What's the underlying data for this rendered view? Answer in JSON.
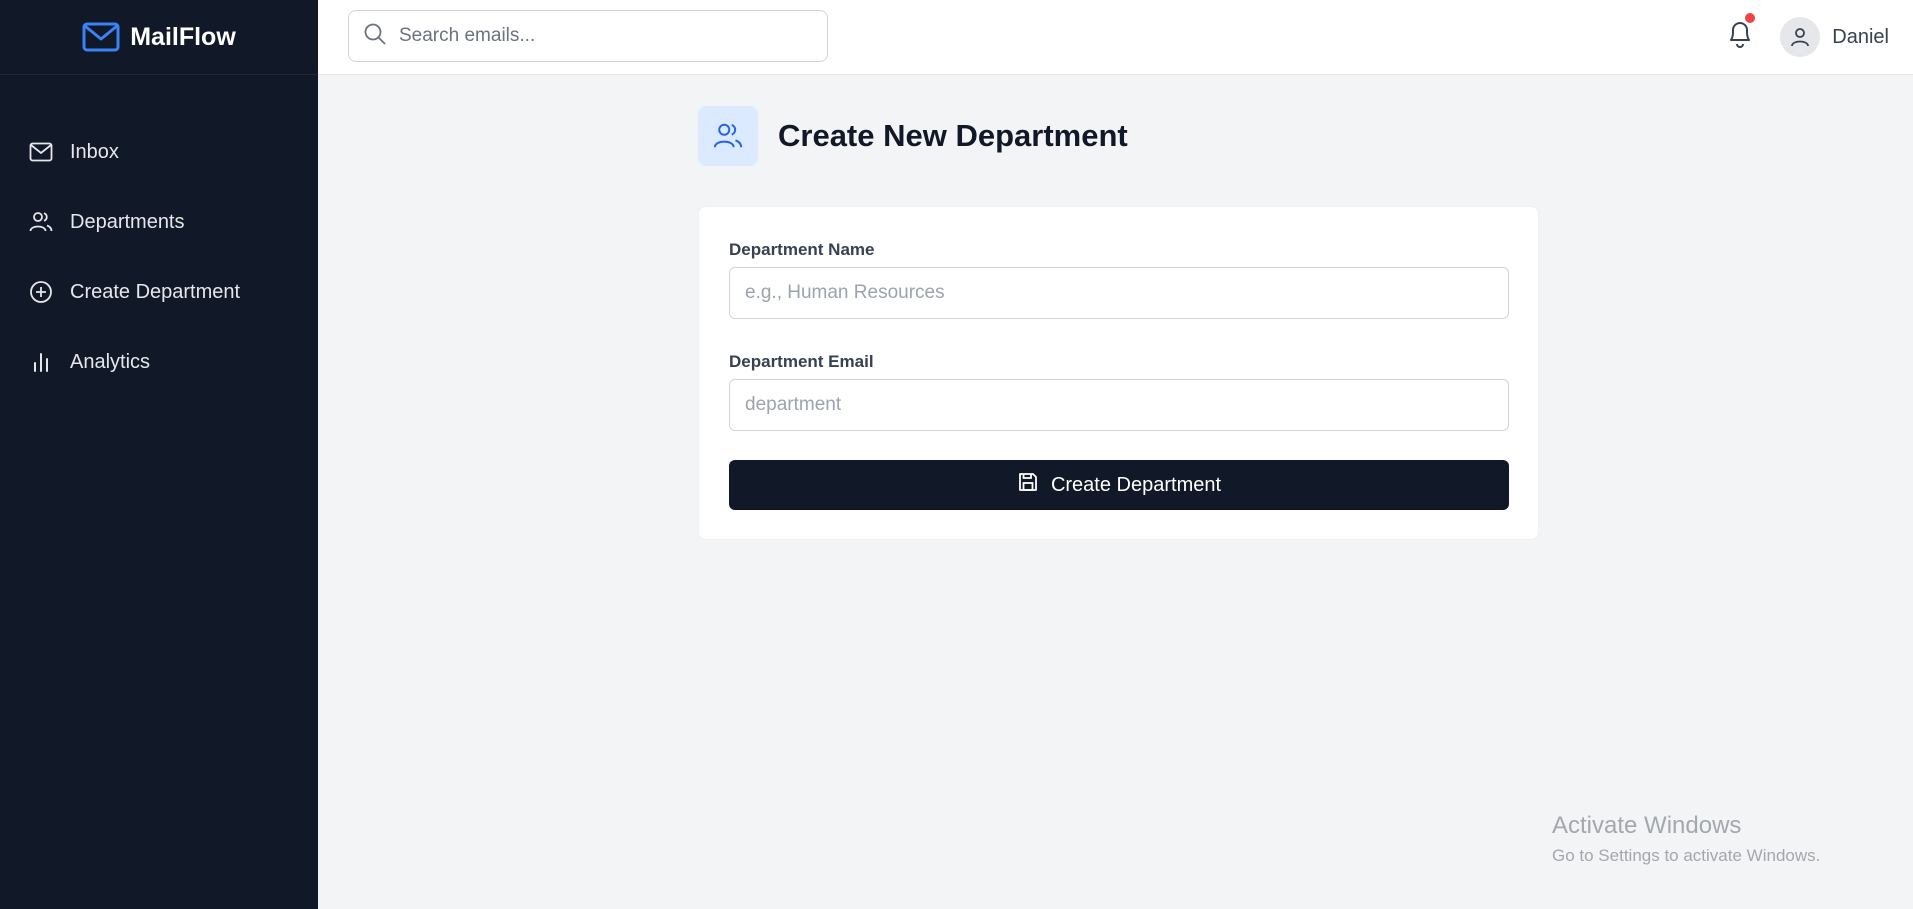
{
  "app": {
    "name": "MailFlow"
  },
  "sidebar": {
    "items": [
      {
        "label": "Inbox",
        "icon": "mail-icon"
      },
      {
        "label": "Departments",
        "icon": "users-icon"
      },
      {
        "label": "Create Department",
        "icon": "plus-circle-icon"
      },
      {
        "label": "Analytics",
        "icon": "bar-chart-icon"
      }
    ]
  },
  "topbar": {
    "search_placeholder": "Search emails...",
    "notification_badge": true,
    "user_name": "Daniel"
  },
  "page": {
    "title": "Create New Department",
    "icon": "users-icon"
  },
  "form": {
    "name_label": "Department Name",
    "name_placeholder": "e.g., Human Resources",
    "name_value": "",
    "email_label": "Department Email",
    "email_placeholder": "department",
    "email_value": "",
    "submit_label": "Create Department",
    "submit_icon": "save-icon"
  },
  "watermark": {
    "title": "Activate Windows",
    "subtitle": "Go to Settings to activate Windows."
  },
  "colors": {
    "sidebar_bg": "#111827",
    "accent": "#3b82f6",
    "page_bg": "#f3f4f6",
    "button_bg": "#111827",
    "badge": "#ef4444"
  }
}
